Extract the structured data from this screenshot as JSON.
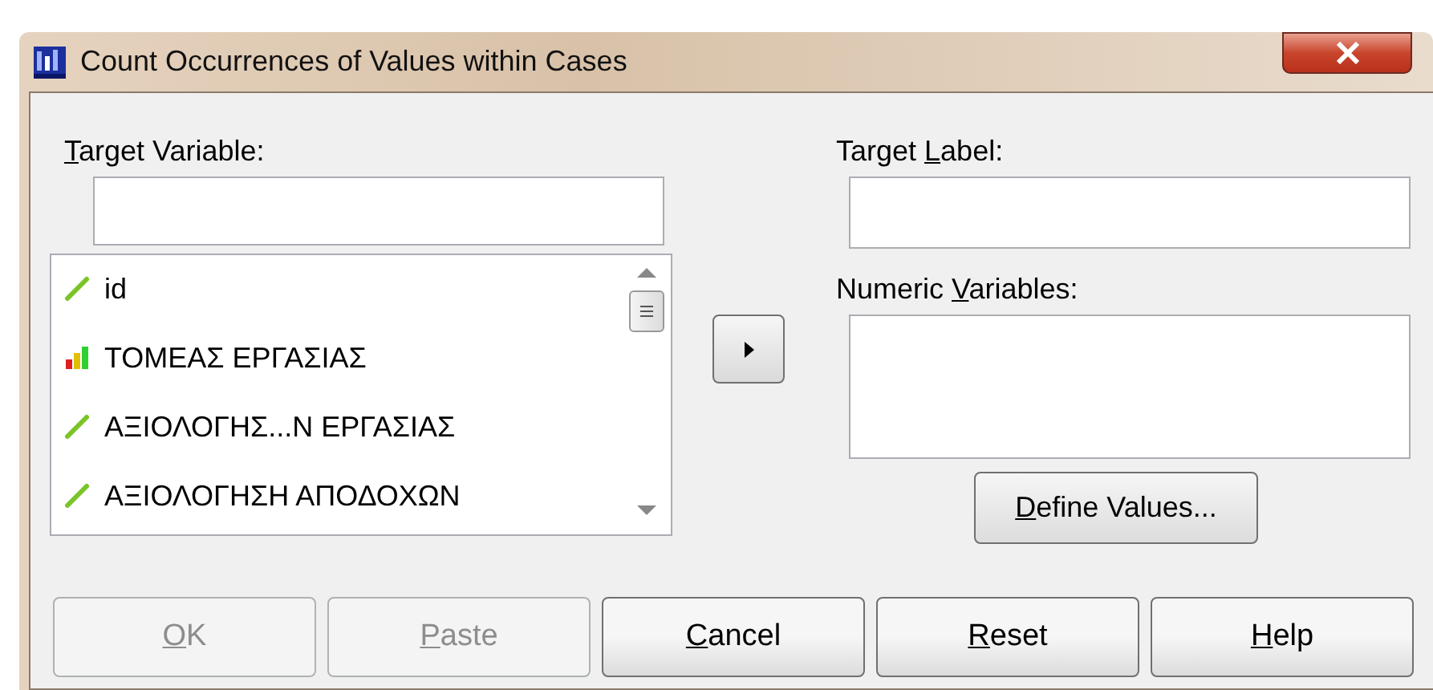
{
  "window": {
    "title": "Count Occurrences of Values within Cases"
  },
  "target_variable": {
    "label": {
      "key": "T",
      "after": "arget Variable:"
    }
  },
  "variables": [
    {
      "name": "id",
      "kind": "scale"
    },
    {
      "name": "ΤΟΜΕΑΣ ΕΡΓΑΣΙΑΣ",
      "kind": "ordinal"
    },
    {
      "name": "ΑΞΙΟΛΟΓΗΣ...Ν ΕΡΓΑΣΙΑΣ",
      "kind": "scale"
    },
    {
      "name": "ΑΞΙΟΛΟΓΗΣΗ ΑΠΟΔΟΧΩΝ",
      "kind": "scale"
    }
  ],
  "target_label": {
    "label": {
      "before": "Target ",
      "key": "L",
      "after": "abel:"
    }
  },
  "numeric_variables": {
    "label": {
      "before": "Numeric ",
      "key": "V",
      "after": "ariables:"
    }
  },
  "define_values": {
    "key": "D",
    "after": "efine Values..."
  },
  "buttons": [
    {
      "key": "O",
      "after": "K",
      "disabled": true
    },
    {
      "key": "P",
      "after": "aste",
      "disabled": true
    },
    {
      "key": "C",
      "after": "ancel",
      "disabled": false
    },
    {
      "key": "R",
      "after": "eset",
      "disabled": false
    },
    {
      "key": "H",
      "after": "elp",
      "disabled": false
    }
  ]
}
